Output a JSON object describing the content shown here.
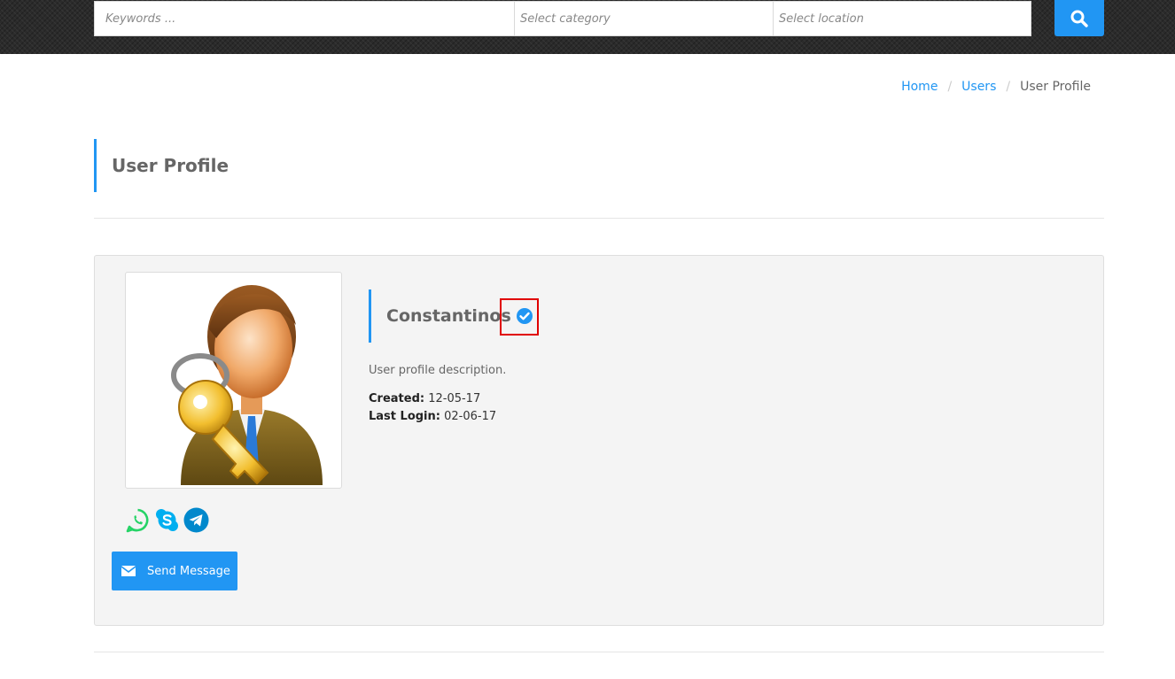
{
  "search": {
    "keywords_placeholder": "Keywords ...",
    "category_placeholder": "Select category",
    "location_placeholder": "Select location",
    "button_icon": "search-icon"
  },
  "breadcrumb": {
    "home": "Home",
    "users": "Users",
    "current": "User Profile",
    "separator": "/"
  },
  "page": {
    "title": "User Profile"
  },
  "profile": {
    "name": "Constantinos",
    "verified_icon": "verified-check-icon",
    "description": "User profile description.",
    "created_label": "Created:",
    "created_value": "12-05-17",
    "last_login_label": "Last Login:",
    "last_login_value": "02-06-17",
    "avatar_icon": "user-with-key-avatar",
    "socials": [
      "whatsapp-icon",
      "skype-icon",
      "telegram-icon"
    ],
    "send_message_label": "Send Message"
  },
  "colors": {
    "accent": "#2196f3",
    "card_bg": "#f4f4f4",
    "highlight": "#e00000",
    "whatsapp": "#25d366",
    "skype": "#00aff0",
    "telegram": "#0088cc"
  }
}
